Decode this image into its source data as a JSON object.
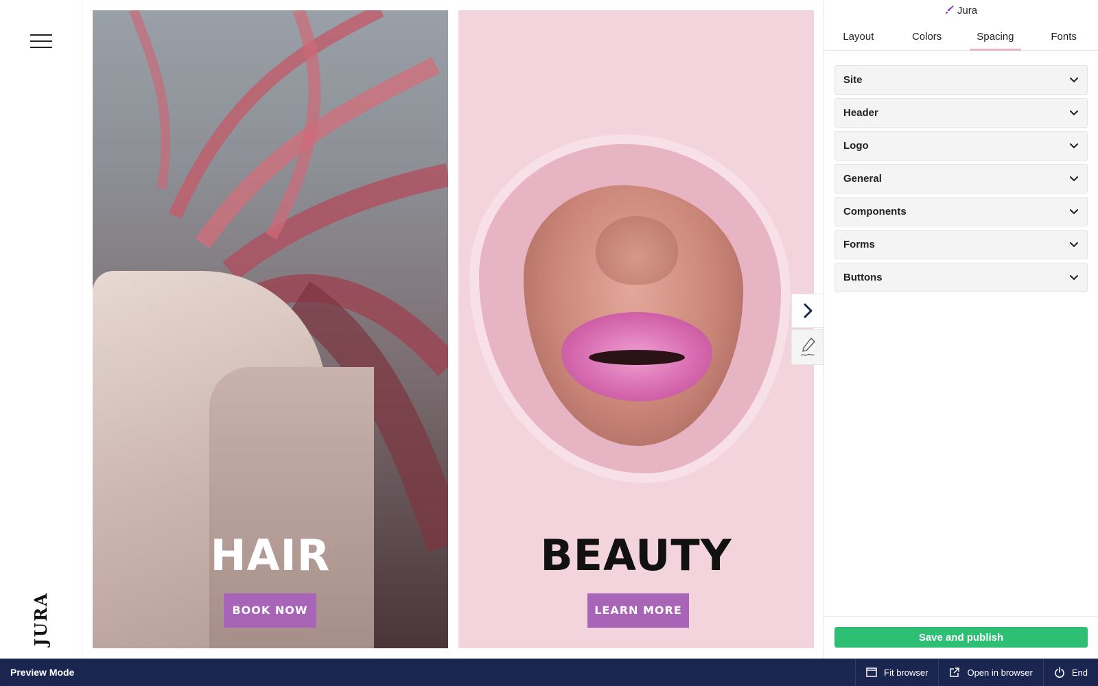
{
  "left_rail": {
    "logo_text": "JURA"
  },
  "panels": [
    {
      "title": "HAIR",
      "cta": "BOOK NOW"
    },
    {
      "title": "BEAUTY",
      "cta": "LEARN MORE"
    }
  ],
  "sidebar": {
    "theme_name": "Jura",
    "tabs": [
      "Layout",
      "Colors",
      "Spacing",
      "Fonts"
    ],
    "active_tab": "Spacing",
    "sections": [
      "Site",
      "Header",
      "Logo",
      "General",
      "Components",
      "Forms",
      "Buttons"
    ],
    "publish_label": "Save and publish"
  },
  "bottom_bar": {
    "mode_label": "Preview Mode",
    "actions": [
      "Fit browser",
      "Open in browser",
      "End"
    ]
  },
  "colors": {
    "cta": "#a864b6",
    "publish": "#2dbf73",
    "bottom_bar": "#1a2550",
    "active_tab_underline": "#f1b4c1"
  },
  "icons": {
    "menu": "hamburger-icon",
    "arrow": "chevron-right-icon",
    "edit": "pen-icon",
    "section_toggle": "chevron-down-icon",
    "fit_browser": "window-icon",
    "open_in_browser": "external-link-icon",
    "end": "power-icon"
  }
}
